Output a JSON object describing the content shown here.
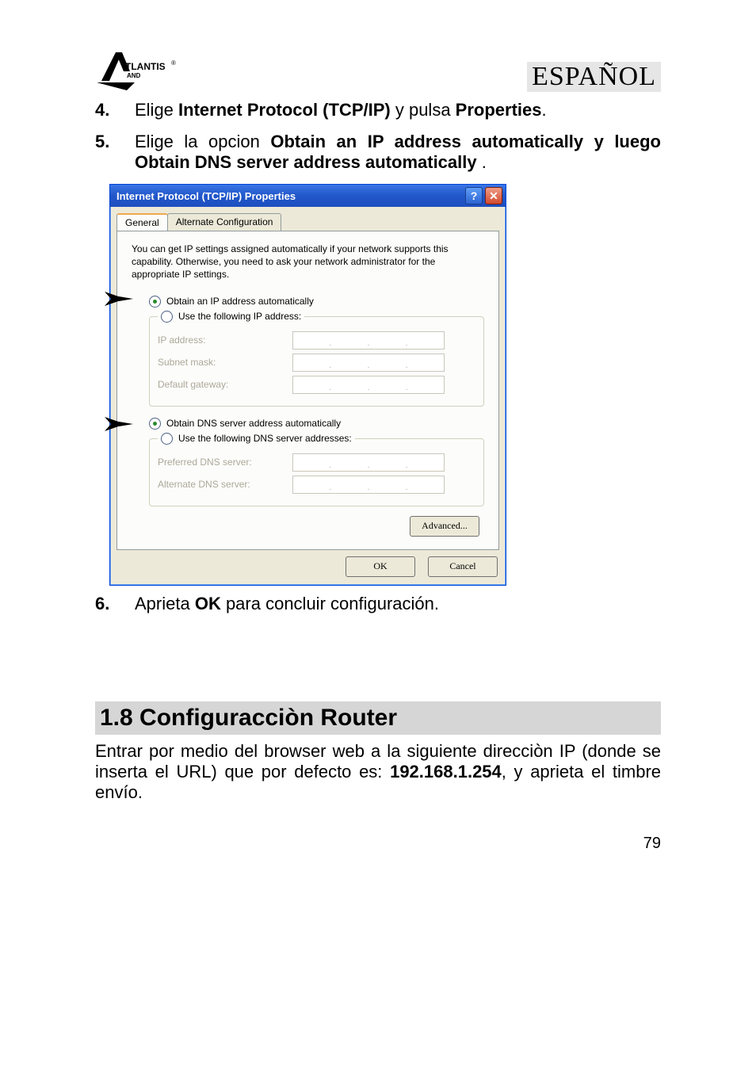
{
  "header": {
    "logo_text": "ATLANTIS",
    "logo_sub": "AND",
    "language": "ESPAÑOL"
  },
  "steps": {
    "s4_num": "4.",
    "s4_a": "Elige ",
    "s4_b": "Internet Protocol (TCP/IP)",
    "s4_c": " y pulsa  ",
    "s4_d": "Properties",
    "s4_e": ".",
    "s5_num": "5.",
    "s5_a": "Elige la opcion ",
    "s5_b": "Obtain an IP address automatically y luego Obtain DNS server address automatically ",
    "s5_c": ".",
    "s6_num": "6.",
    "s6_a": "Aprieta  ",
    "s6_b": "OK",
    "s6_c": " para concluir configuración."
  },
  "dialog": {
    "title": "Internet Protocol (TCP/IP) Properties",
    "tab_general": "General",
    "tab_alt": "Alternate Configuration",
    "description": "You can get IP settings assigned automatically if your network supports this capability. Otherwise, you need to ask your network administrator for the appropriate IP settings.",
    "radio_obtain_ip": "Obtain an IP address automatically",
    "radio_use_ip": "Use the following IP address:",
    "lbl_ip": "IP address:",
    "lbl_subnet": "Subnet mask:",
    "lbl_gateway": "Default gateway:",
    "radio_obtain_dns": "Obtain DNS server address automatically",
    "radio_use_dns": "Use the following DNS server addresses:",
    "lbl_pref_dns": "Preferred DNS server:",
    "lbl_alt_dns": "Alternate DNS server:",
    "btn_advanced": "Advanced...",
    "btn_ok": "OK",
    "btn_cancel": "Cancel"
  },
  "section": {
    "title": "1.8 Configuracciòn Router",
    "body_a": "Entrar por medio del browser web a la siguiente direcciòn IP (donde se inserta el URL) que por defecto es: ",
    "body_b": "192.168.1.254",
    "body_c": ", y aprieta el timbre  envío."
  },
  "page_number": "79"
}
